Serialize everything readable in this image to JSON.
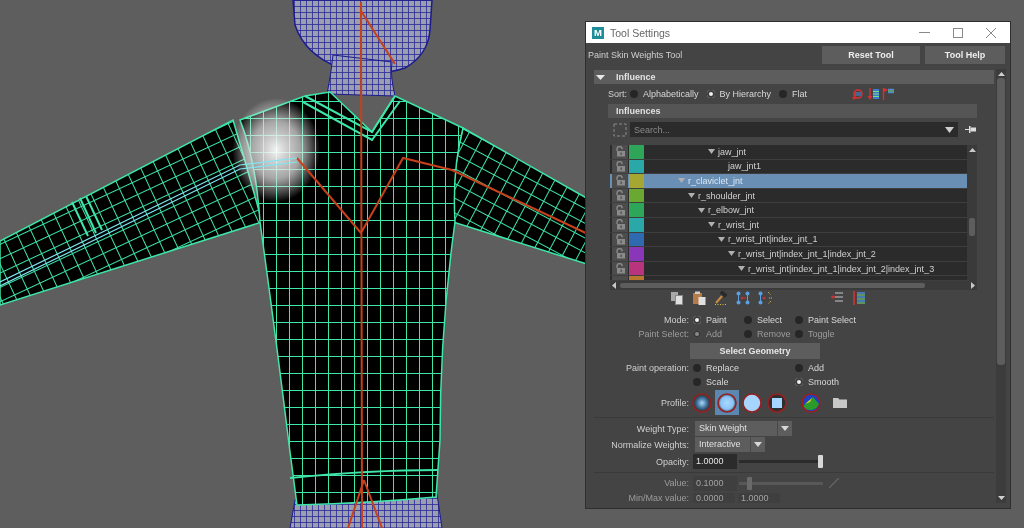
{
  "window": {
    "logo": "M",
    "title": "Tool Settings"
  },
  "tool": {
    "name": "Paint Skin Weights Tool",
    "buttons": [
      "Reset Tool",
      "Tool Help"
    ]
  },
  "influence": {
    "title": "Influence",
    "expanded": true,
    "sort": {
      "label": "Sort:",
      "options": [
        {
          "label": "Alphabetically",
          "selected": false
        },
        {
          "label": "By Hierarchy",
          "selected": true
        },
        {
          "label": "Flat",
          "selected": false
        }
      ]
    },
    "influences": {
      "title": "Influences",
      "search": {
        "placeholder": "Search..."
      },
      "tree": [
        {
          "children": [
            {
              "children": [
                {
                  "children": [
                    {
                      "label": "jaw_jnt",
                      "color": "#2ea65a",
                      "expanded": true,
                      "selected": false,
                      "children": [
                        {
                          "label": "jaw_jnt1",
                          "color": "#2aa8a8",
                          "selected": false
                        }
                      ]
                    }
                  ]
                }
              ]
            }
          ]
        },
        {
          "label": "r_claviclet_jnt",
          "color": "#a6a632",
          "expanded": true,
          "selected": true,
          "children": [
            {
              "label": "r_shoulder_jnt",
              "color": "#6aa832",
              "expanded": true,
              "selected": false,
              "children": [
                {
                  "label": "r_elbow_jnt",
                  "color": "#2ea65a",
                  "expanded": true,
                  "selected": false,
                  "children": [
                    {
                      "label": "r_wrist_jnt",
                      "color": "#2aa8a8",
                      "expanded": true,
                      "selected": false,
                      "children": [
                        {
                          "label": "r_wrist_jnt|index_jnt_1",
                          "color": "#2f6ab0",
                          "expanded": true,
                          "selected": false,
                          "children": [
                            {
                              "label": "r_wrist_jnt|index_jnt_1|index_jnt_2",
                              "color": "#8a36b8",
                              "expanded": true,
                              "selected": false,
                              "children": [
                                {
                                  "label": "r_wrist_jnt|index_jnt_1|index_jnt_2|index_jnt_3",
                                  "color": "#b8347c",
                                  "expanded": true,
                                  "selected": false,
                                  "children": [
                                    {
                                      "color": "#b8762e",
                                      "selected": false
                                    }
                                  ]
                                }
                              ]
                            }
                          ]
                        }
                      ]
                    }
                  ]
                }
              ]
            }
          ]
        }
      ]
    }
  },
  "mode": {
    "label": "Mode:",
    "options": [
      {
        "label": "Paint",
        "selected": true
      },
      {
        "label": "Select",
        "selected": false
      },
      {
        "label": "Paint Select",
        "selected": false
      }
    ]
  },
  "paint_select": {
    "label": "Paint Select:",
    "disabled": true,
    "options": [
      {
        "label": "Add",
        "selected": true
      },
      {
        "label": "Remove",
        "selected": false
      },
      {
        "label": "Toggle",
        "selected": false
      }
    ]
  },
  "select_geometry": "Select Geometry",
  "paint_operation": {
    "label": "Paint operation:",
    "options": [
      {
        "label": "Replace",
        "selected": false
      },
      {
        "label": "Add",
        "selected": false
      },
      {
        "label": "Scale",
        "selected": false
      },
      {
        "label": "Smooth",
        "selected": true
      }
    ]
  },
  "profile": {
    "label": "Profile:",
    "brushes": [
      {
        "kind": "gaussian",
        "selected": false
      },
      {
        "kind": "soft",
        "selected": true
      },
      {
        "kind": "solid",
        "selected": false
      },
      {
        "kind": "square",
        "selected": false
      },
      {
        "kind": "image",
        "selected": false
      }
    ]
  },
  "weight_type": {
    "label": "Weight Type:",
    "value": "Skin Weight"
  },
  "normalize_weights": {
    "label": "Normalize Weights:",
    "value": "Interactive"
  },
  "opacity": {
    "label": "Opacity:",
    "value": "1.0000",
    "level": 1
  },
  "value": {
    "label": "Value:",
    "value": "0.1000",
    "level": 0.1,
    "disabled": true
  },
  "min_max_value": {
    "label": "Min/Max value:",
    "values": [
      "0.0000",
      "1.0000"
    ],
    "disabled": true
  }
}
